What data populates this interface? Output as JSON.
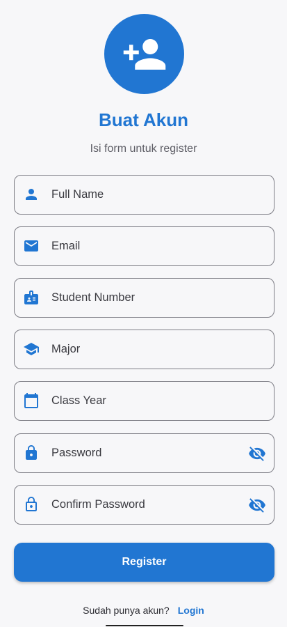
{
  "header": {
    "title": "Buat Akun",
    "subtitle": "Isi form untuk register",
    "avatar_icon": "person-add-icon"
  },
  "colors": {
    "primary": "#2176d2",
    "background": "#f7f7f9",
    "outline": "#7d7d85",
    "text": "#3a3a40"
  },
  "form": {
    "fields": [
      {
        "label": "Full Name",
        "icon": "person-icon"
      },
      {
        "label": "Email",
        "icon": "email-icon"
      },
      {
        "label": "Student Number",
        "icon": "badge-icon"
      },
      {
        "label": "Major",
        "icon": "school-icon"
      },
      {
        "label": "Class Year",
        "icon": "calendar-icon"
      },
      {
        "label": "Password",
        "icon": "lock-icon",
        "trailing_icon": "visibility-off-icon"
      },
      {
        "label": "Confirm Password",
        "icon": "lock-outline-icon",
        "trailing_icon": "visibility-off-icon"
      }
    ],
    "submit_label": "Register"
  },
  "footer": {
    "prompt": "Sudah punya akun?",
    "login_label": "Login"
  }
}
